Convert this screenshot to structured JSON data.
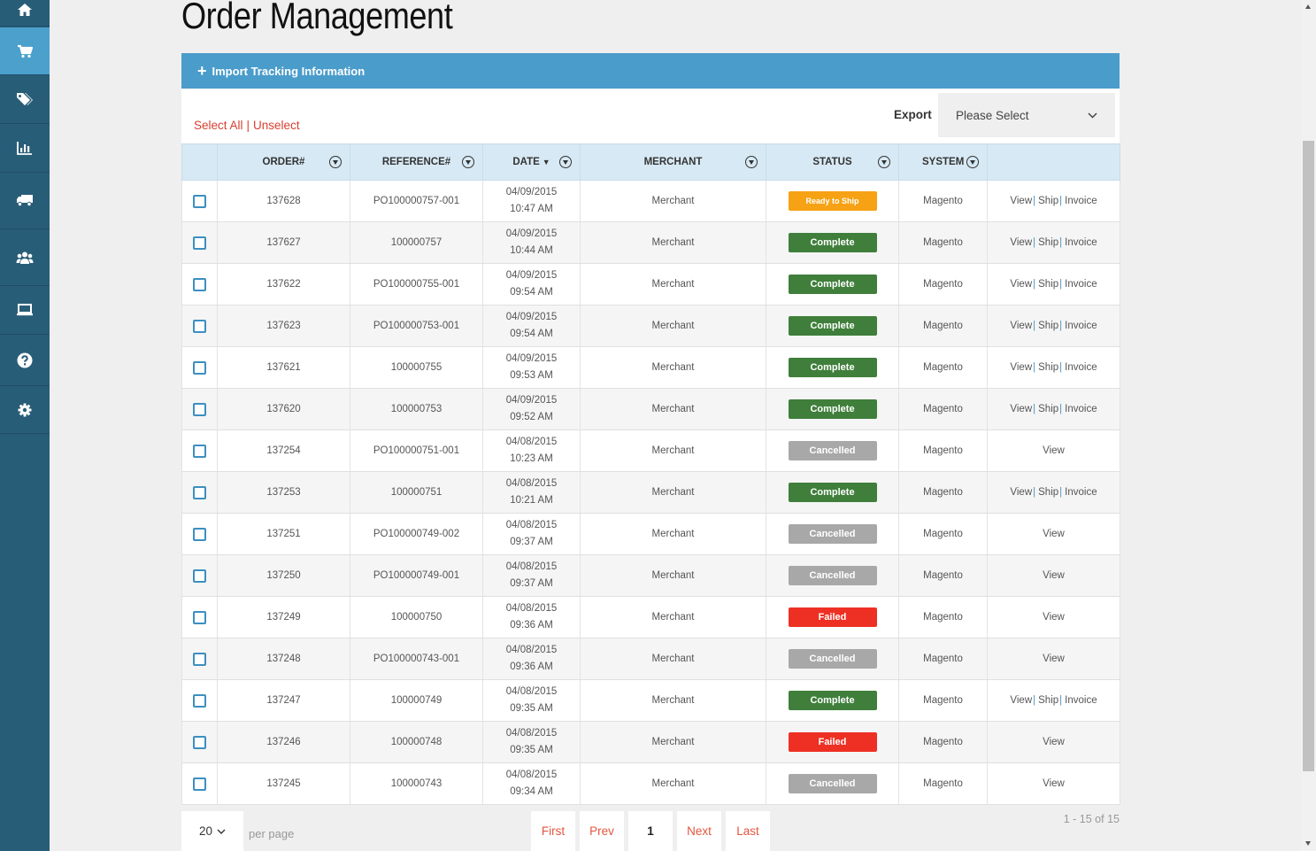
{
  "sidebar": {
    "items": [
      {
        "name": "home-icon",
        "active": false
      },
      {
        "name": "cart-icon",
        "active": true
      },
      {
        "name": "tags-icon",
        "active": false
      },
      {
        "name": "bar-chart-icon",
        "active": false
      },
      {
        "name": "truck-icon",
        "active": false
      },
      {
        "name": "users-icon",
        "active": false
      },
      {
        "name": "laptop-icon",
        "active": false
      },
      {
        "name": "question-icon",
        "active": false
      },
      {
        "name": "gear-icon",
        "active": false
      }
    ]
  },
  "page": {
    "title": "Order Management"
  },
  "import_bar": {
    "icon": "plus-icon",
    "label": "Import Tracking Information"
  },
  "toolbar": {
    "select_all": "Select All",
    "separator": "|",
    "unselect": "Unselect",
    "export_label": "Export",
    "export_value": "Please Select"
  },
  "table": {
    "columns": {
      "order": "ORDER#",
      "reference": "REFERENCE#",
      "date": "DATE",
      "merchant": "MERCHANT",
      "status": "STATUS",
      "system": "SYSTEM"
    },
    "actions": {
      "view": "View",
      "ship": "Ship",
      "invoice": "Invoice",
      "sep": "|"
    },
    "rows": [
      {
        "order": "137628",
        "reference": "PO100000757-001",
        "date": "04/09/2015",
        "time": "10:47 AM",
        "merchant": "Merchant",
        "status": "Ready to Ship",
        "status_type": "ready",
        "system": "Magento",
        "full_actions": true
      },
      {
        "order": "137627",
        "reference": "100000757",
        "date": "04/09/2015",
        "time": "10:44 AM",
        "merchant": "Merchant",
        "status": "Complete",
        "status_type": "complete",
        "system": "Magento",
        "full_actions": true
      },
      {
        "order": "137622",
        "reference": "PO100000755-001",
        "date": "04/09/2015",
        "time": "09:54 AM",
        "merchant": "Merchant",
        "status": "Complete",
        "status_type": "complete",
        "system": "Magento",
        "full_actions": true
      },
      {
        "order": "137623",
        "reference": "PO100000753-001",
        "date": "04/09/2015",
        "time": "09:54 AM",
        "merchant": "Merchant",
        "status": "Complete",
        "status_type": "complete",
        "system": "Magento",
        "full_actions": true
      },
      {
        "order": "137621",
        "reference": "100000755",
        "date": "04/09/2015",
        "time": "09:53 AM",
        "merchant": "Merchant",
        "status": "Complete",
        "status_type": "complete",
        "system": "Magento",
        "full_actions": true
      },
      {
        "order": "137620",
        "reference": "100000753",
        "date": "04/09/2015",
        "time": "09:52 AM",
        "merchant": "Merchant",
        "status": "Complete",
        "status_type": "complete",
        "system": "Magento",
        "full_actions": true
      },
      {
        "order": "137254",
        "reference": "PO100000751-001",
        "date": "04/08/2015",
        "time": "10:23 AM",
        "merchant": "Merchant",
        "status": "Cancelled",
        "status_type": "cancelled",
        "system": "Magento",
        "full_actions": false
      },
      {
        "order": "137253",
        "reference": "100000751",
        "date": "04/08/2015",
        "time": "10:21 AM",
        "merchant": "Merchant",
        "status": "Complete",
        "status_type": "complete",
        "system": "Magento",
        "full_actions": true
      },
      {
        "order": "137251",
        "reference": "PO100000749-002",
        "date": "04/08/2015",
        "time": "09:37 AM",
        "merchant": "Merchant",
        "status": "Cancelled",
        "status_type": "cancelled",
        "system": "Magento",
        "full_actions": false
      },
      {
        "order": "137250",
        "reference": "PO100000749-001",
        "date": "04/08/2015",
        "time": "09:37 AM",
        "merchant": "Merchant",
        "status": "Cancelled",
        "status_type": "cancelled",
        "system": "Magento",
        "full_actions": false
      },
      {
        "order": "137249",
        "reference": "100000750",
        "date": "04/08/2015",
        "time": "09:36 AM",
        "merchant": "Merchant",
        "status": "Failed",
        "status_type": "failed",
        "system": "Magento",
        "full_actions": false
      },
      {
        "order": "137248",
        "reference": "PO100000743-001",
        "date": "04/08/2015",
        "time": "09:36 AM",
        "merchant": "Merchant",
        "status": "Cancelled",
        "status_type": "cancelled",
        "system": "Magento",
        "full_actions": false
      },
      {
        "order": "137247",
        "reference": "100000749",
        "date": "04/08/2015",
        "time": "09:35 AM",
        "merchant": "Merchant",
        "status": "Complete",
        "status_type": "complete",
        "system": "Magento",
        "full_actions": true
      },
      {
        "order": "137246",
        "reference": "100000748",
        "date": "04/08/2015",
        "time": "09:35 AM",
        "merchant": "Merchant",
        "status": "Failed",
        "status_type": "failed",
        "system": "Magento",
        "full_actions": false
      },
      {
        "order": "137245",
        "reference": "100000743",
        "date": "04/08/2015",
        "time": "09:34 AM",
        "merchant": "Merchant",
        "status": "Cancelled",
        "status_type": "cancelled",
        "system": "Magento",
        "full_actions": false
      }
    ]
  },
  "footer": {
    "per_page_value": "20",
    "per_page_label": "per page",
    "first": "First",
    "prev": "Prev",
    "current_page": "1",
    "next": "Next",
    "last": "Last",
    "range": "1 - 15 of 15"
  },
  "colors": {
    "sidebar": "#285d78",
    "sidebar_active": "#4ba0cc",
    "header_bar": "#4a9ccb",
    "link_red": "#d9402f",
    "link_blue": "#4d95c4",
    "status_ready": "#f6a214",
    "status_complete": "#3f7f3b",
    "status_cancelled": "#a8a8a8",
    "status_failed": "#ee3024"
  }
}
